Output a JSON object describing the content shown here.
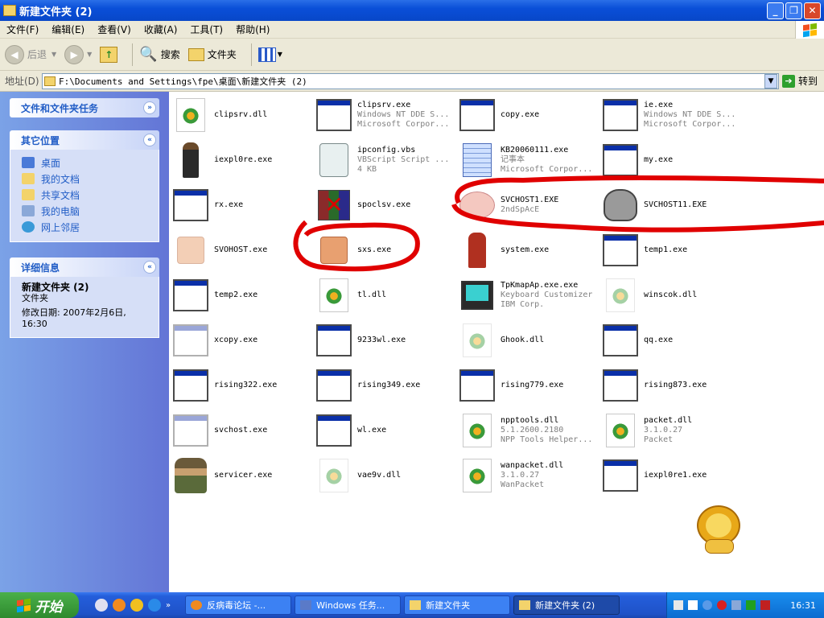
{
  "window": {
    "title": "新建文件夹 (2)"
  },
  "menu": [
    "文件(F)",
    "编辑(E)",
    "查看(V)",
    "收藏(A)",
    "工具(T)",
    "帮助(H)"
  ],
  "toolbar": {
    "back_label": "后退",
    "search_label": "搜索",
    "folders_label": "文件夹"
  },
  "address": {
    "label": "地址(D)",
    "path": "F:\\Documents and Settings\\fpe\\桌面\\新建文件夹 (2)",
    "go_label": "转到"
  },
  "left_pane": {
    "tasks_header": "文件和文件夹任务",
    "places_header": "其它位置",
    "places": [
      "桌面",
      "我的文档",
      "共享文档",
      "我的电脑",
      "网上邻居"
    ],
    "details_header": "详细信息",
    "details_name": "新建文件夹 (2)",
    "details_type": "文件夹",
    "details_modified_line1": "修改日期: 2007年2月6日,",
    "details_modified_line2": "16:30"
  },
  "files": [
    {
      "name": "clipsrv.dll",
      "icon": "dll-icon"
    },
    {
      "name": "clipsrv.exe",
      "sub1": "Windows NT DDE S...",
      "sub2": "Microsoft Corpor...",
      "icon": "exe-window-icon"
    },
    {
      "name": "copy.exe",
      "icon": "exe-window-icon"
    },
    {
      "name": "ie.exe",
      "sub1": "Windows NT DDE S...",
      "sub2": "Microsoft Corpor...",
      "icon": "exe-window-icon"
    },
    {
      "name": "iexpl0re.exe",
      "icon": "character-icon"
    },
    {
      "name": "ipconfig.vbs",
      "sub1": "VBScript Script ...",
      "sub2": "4 KB",
      "icon": "vbs-script-icon"
    },
    {
      "name": "KB20060111.exe",
      "sub1": "记事本",
      "sub2": "Microsoft Corpor...",
      "icon": "notepad-icon"
    },
    {
      "name": "my.exe",
      "icon": "exe-window-icon"
    },
    {
      "name": "rx.exe",
      "icon": "exe-window-icon"
    },
    {
      "name": "spoclsv.exe",
      "icon": "winrar-icon"
    },
    {
      "name": "SVCHOST1.EXE",
      "sub1": "2ndSpAcE",
      "icon": "pig-icon"
    },
    {
      "name": "SVCHOST11.EXE",
      "icon": "ghost-icon"
    },
    {
      "name": "SVOHOST.exe",
      "icon": "faded-box-icon"
    },
    {
      "name": "sxs.exe",
      "icon": "box-icon"
    },
    {
      "name": "system.exe",
      "icon": "robot-icon"
    },
    {
      "name": "temp1.exe",
      "icon": "exe-window-icon"
    },
    {
      "name": "temp2.exe",
      "icon": "exe-window-icon"
    },
    {
      "name": "tl.dll",
      "icon": "dll-icon"
    },
    {
      "name": "TpKmapAp.exe.exe",
      "sub1": "Keyboard Customizer",
      "sub2": "IBM Corp.",
      "icon": "computer-icon"
    },
    {
      "name": "winscok.dll",
      "icon": "faded-dll-icon"
    },
    {
      "name": "xcopy.exe",
      "icon": "faded-exe-icon"
    },
    {
      "name": "9233wl.exe",
      "icon": "exe-window-icon"
    },
    {
      "name": "Ghook.dll",
      "icon": "faded-dll-icon"
    },
    {
      "name": "qq.exe",
      "icon": "exe-window-icon"
    },
    {
      "name": "rising322.exe",
      "icon": "exe-window-icon"
    },
    {
      "name": "rising349.exe",
      "icon": "exe-window-icon"
    },
    {
      "name": "rising779.exe",
      "icon": "exe-window-icon"
    },
    {
      "name": "rising873.exe",
      "icon": "exe-window-icon"
    },
    {
      "name": "svchost.exe",
      "icon": "faded-exe-icon"
    },
    {
      "name": "wl.exe",
      "icon": "exe-window-icon"
    },
    {
      "name": "npptools.dll",
      "sub1": "5.1.2600.2180",
      "sub2": "NPP Tools Helper...",
      "icon": "dll-icon"
    },
    {
      "name": "packet.dll",
      "sub1": "3.1.0.27",
      "sub2": "Packet",
      "icon": "dll-icon"
    },
    {
      "name": "servicer.exe",
      "icon": "soldier-icon"
    },
    {
      "name": "vae9v.dll",
      "icon": "faded-dll-icon"
    },
    {
      "name": "wanpacket.dll",
      "sub1": "3.1.0.27",
      "sub2": "WanPacket",
      "icon": "dll-icon"
    },
    {
      "name": "iexpl0re1.exe",
      "icon": "exe-window-icon"
    }
  ],
  "taskbar": {
    "start_label": "开始",
    "tasks": [
      "反病毒论坛 -...",
      "Windows 任务...",
      "新建文件夹",
      "新建文件夹 (2)"
    ],
    "clock": "16:31"
  },
  "colors": {
    "title_bar": "#0a4fd8",
    "left_pane": "#6375d6",
    "annotation_circle": "#e00000",
    "taskbar": "#245edb",
    "start_button": "#2e8a2e"
  }
}
